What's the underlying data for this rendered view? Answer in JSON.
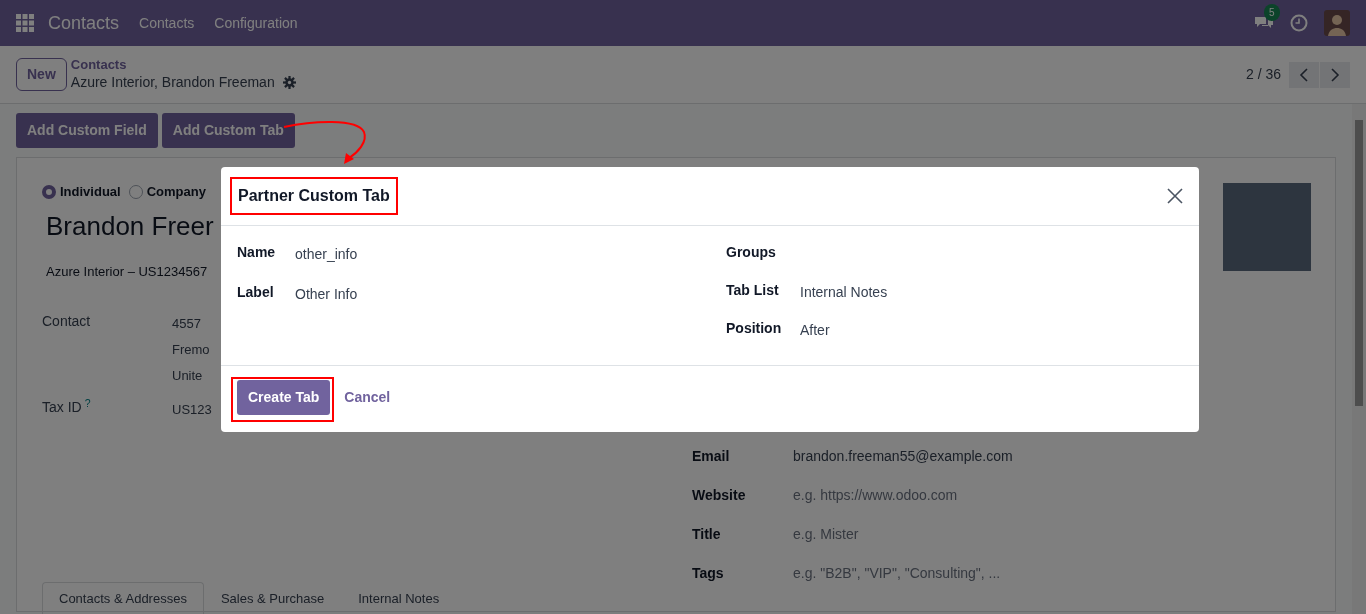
{
  "navbar": {
    "app_name": "Contacts",
    "menu": [
      "Contacts",
      "Configuration"
    ],
    "message_count": "5"
  },
  "control_panel": {
    "new_button": "New",
    "breadcrumb": "Contacts",
    "record_title": "Azure Interior, Brandon Freeman",
    "pager": "2 / 36"
  },
  "actions": [
    "Add Custom Field",
    "Add Custom Tab"
  ],
  "form": {
    "company_types": [
      {
        "label": "Individual",
        "selected": true
      },
      {
        "label": "Company",
        "selected": false
      }
    ],
    "name": "Brandon Freer",
    "company_line": "Azure Interior – US1234567",
    "left_fields": [
      {
        "label": "Contact",
        "lines": [
          "4557",
          "Fremo",
          "Unite"
        ]
      },
      {
        "label": "Tax ID",
        "help": "?",
        "lines": [
          "US123"
        ]
      }
    ],
    "right_fields": [
      {
        "label": "Email",
        "value": "brandon.freeman55@example.com"
      },
      {
        "label": "Website",
        "placeholder": "e.g. https://www.odoo.com"
      },
      {
        "label": "Title",
        "placeholder": "e.g. Mister"
      },
      {
        "label": "Tags",
        "placeholder": "e.g. \"B2B\", \"VIP\", \"Consulting\", ..."
      }
    ],
    "tabs": [
      {
        "label": "Contacts & Addresses",
        "selected": true
      },
      {
        "label": "Sales & Purchase",
        "selected": false
      },
      {
        "label": "Internal Notes",
        "selected": false
      }
    ]
  },
  "modal": {
    "title": "Partner Custom Tab",
    "left_fields": [
      {
        "label": "Name",
        "value": "other_info"
      },
      {
        "label": "Label",
        "value": "Other Info"
      }
    ],
    "right_fields": [
      {
        "label": "Groups"
      },
      {
        "label": "Tab List",
        "value": "Internal Notes"
      },
      {
        "label": "Position",
        "value": "After"
      }
    ],
    "primary_button": "Create Tab",
    "cancel_button": "Cancel"
  }
}
